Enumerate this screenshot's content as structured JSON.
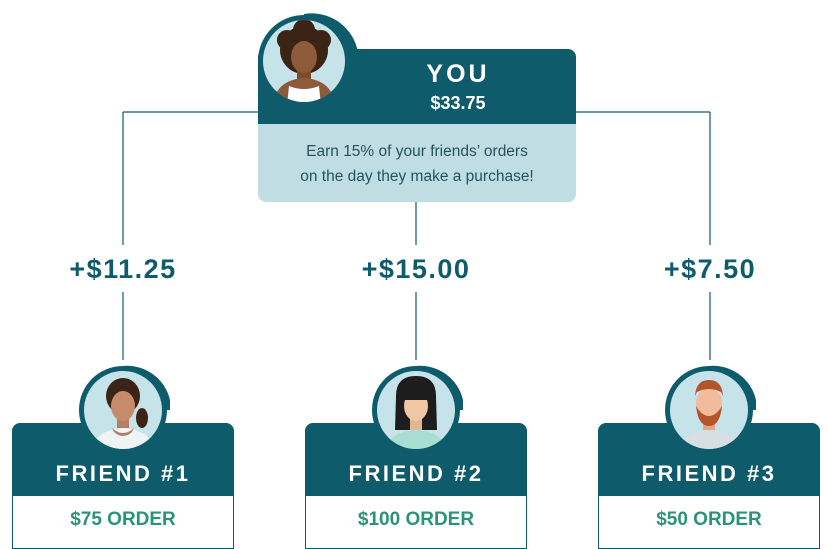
{
  "you": {
    "title": "YOU",
    "amount": "$33.75",
    "description_line1": "Earn 15% of your friends’ orders",
    "description_line2": "on the day they make a purchase!",
    "avatar_icon": "woman-curly-hair-avatar-icon"
  },
  "earnings": [
    "+$11.25",
    "+$15.00",
    "+$7.50"
  ],
  "friends": [
    {
      "name": "FRIEND #1",
      "order": "$75 ORDER",
      "avatar_icon": "woman-ponytail-avatar-icon"
    },
    {
      "name": "FRIEND #2",
      "order": "$100 ORDER",
      "avatar_icon": "woman-bangs-avatar-icon"
    },
    {
      "name": "FRIEND #3",
      "order": "$50 ORDER",
      "avatar_icon": "man-beard-avatar-icon"
    }
  ],
  "colors": {
    "dark_teal": "#0d5b6b",
    "light_teal": "#c0dde3",
    "order_green": "#2a9476",
    "avatar_bg": "#c7e3ea"
  }
}
